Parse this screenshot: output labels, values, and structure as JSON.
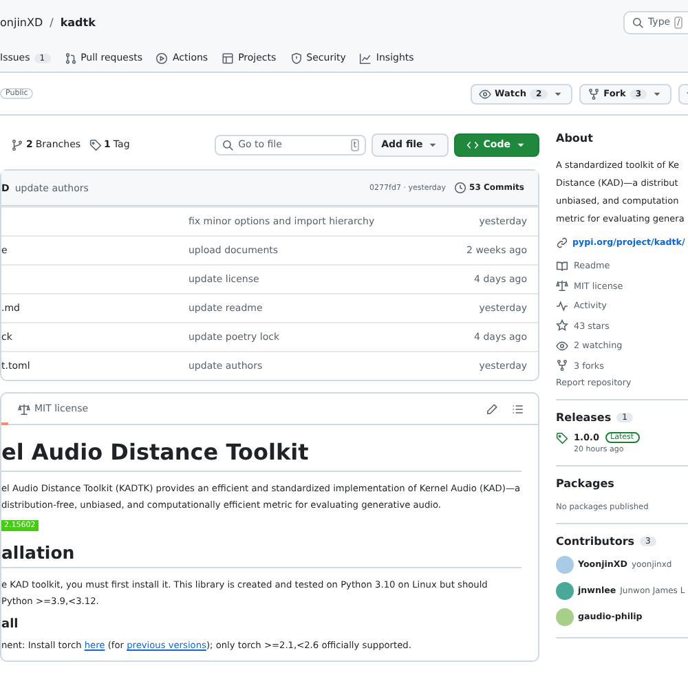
{
  "header": {
    "owner": "onjinXD",
    "separator": "/",
    "repo": "kadtk",
    "search_placeholder": "Type",
    "search_key": "/"
  },
  "nav": [
    {
      "kind": "none",
      "label": "Issues",
      "count": "1"
    },
    {
      "kind": "pr",
      "label": "Pull requests"
    },
    {
      "kind": "play",
      "label": "Actions"
    },
    {
      "kind": "table",
      "label": "Projects"
    },
    {
      "kind": "shield",
      "label": "Security"
    },
    {
      "kind": "graph",
      "label": "Insights"
    }
  ],
  "visibility": "Public",
  "repo_actions": [
    {
      "kind": "eye",
      "label": "Watch",
      "count": "2"
    },
    {
      "kind": "fork",
      "label": "Fork",
      "count": "3"
    }
  ],
  "branch_bar": {
    "branches_count": "2",
    "branches": "Branches",
    "tags_count": "1",
    "tags": "Tag",
    "goto_placeholder": "Go to file",
    "goto_key": "t",
    "add_file": "Add file",
    "code": "Code"
  },
  "commit": {
    "author": "D",
    "message": "update authors",
    "hash_time": "0277fd7 · yesterday",
    "commits": "53 Commits"
  },
  "files": [
    {
      "message": "fix minor options and import hierarchy",
      "time": "yesterday"
    },
    {
      "name": "e",
      "message": "upload documents",
      "time": "2 weeks ago"
    },
    {
      "message": "update license",
      "time": "4 days ago"
    },
    {
      "name": ".md",
      "message": "update readme",
      "time": "yesterday"
    },
    {
      "name": "ck",
      "message": "update poetry lock",
      "time": "4 days ago"
    },
    {
      "name": "t.toml",
      "message": "update authors",
      "time": "yesterday"
    }
  ],
  "readme_bar": {
    "license": "MIT license"
  },
  "readme": [
    {
      "kind": "h1",
      "text": "el Audio Distance Toolkit"
    },
    {
      "kind": "p",
      "parts": [
        {
          "kind": "text",
          "text": "el Audio Distance Toolkit (KADTK) provides an efficient and standardized implementation of Kernel Audio (KAD)—a distribution-free, unbiased, and computationally efficient metric for evaluating generative audio."
        }
      ]
    },
    {
      "kind": "badge",
      "text": "2.15602"
    },
    {
      "kind": "h2",
      "text": "allation"
    },
    {
      "kind": "p",
      "parts": [
        {
          "kind": "text",
          "text": "e KAD toolkit, you must first install it. This library is created and tested on Python 3.10 on Linux but should Python >=3.9,<3.12."
        }
      ]
    },
    {
      "kind": "h3",
      "text": "all"
    },
    {
      "kind": "p",
      "parts": [
        {
          "kind": "text",
          "text": "nent: Install torch "
        },
        {
          "kind": "link",
          "text": "here"
        },
        {
          "kind": "text",
          "text": " (for "
        },
        {
          "kind": "link",
          "text": "previous versions"
        },
        {
          "kind": "text",
          "text": "); only torch >=2.1,<2.6 officially supported."
        }
      ]
    }
  ],
  "sidebar": {
    "about_title": "About",
    "description": [
      "A standardized toolkit of Ke",
      "Distance (KAD)—a distribut",
      "unbiased, and computation",
      "metric for evaluating genera"
    ],
    "website": "pypi.org/project/kadtk/",
    "meta": [
      {
        "kind": "book",
        "label": "Readme"
      },
      {
        "kind": "scale",
        "label": "MIT license"
      },
      {
        "kind": "pulse",
        "label": "Activity"
      },
      {
        "kind": "star",
        "label": "43 stars"
      },
      {
        "kind": "eye",
        "label": "2 watching"
      },
      {
        "kind": "fork",
        "label": "3 forks"
      }
    ],
    "report": "Report repository",
    "releases_title": "Releases",
    "releases_count": "1",
    "release": {
      "version": "1.0.0",
      "badge": "Latest",
      "time": "20 hours ago"
    },
    "packages_title": "Packages",
    "packages_note": "No packages published",
    "contributors_title": "Contributors",
    "contributors_count": "3",
    "contributors": [
      {
        "login": "YoonjinXD",
        "name": "yoonjinxd",
        "color": "#a9cbe8"
      },
      {
        "login": "jnwnlee",
        "name": "Junwon James L",
        "color": "#4aa89a"
      },
      {
        "login": "gaudio-philip",
        "color": "#a8cf8a"
      }
    ]
  }
}
